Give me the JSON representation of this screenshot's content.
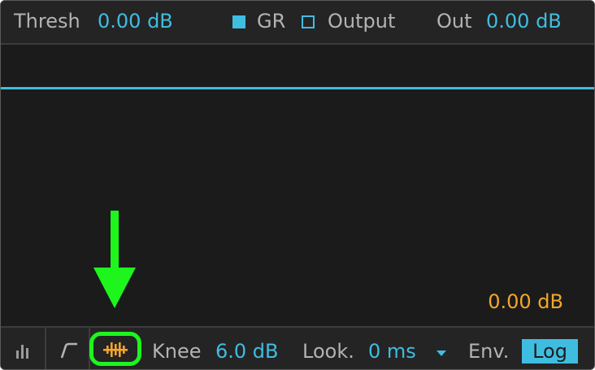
{
  "top_bar": {
    "threshold_label": "Thresh",
    "threshold_value": "0.00 dB",
    "gr_label": "GR",
    "gr_checked": true,
    "output_label": "Output",
    "output_checked": false,
    "out_label": "Out",
    "out_value": "0.00 dB"
  },
  "display": {
    "gr_readout": "0.00 dB"
  },
  "bottom_bar": {
    "knee_label": "Knee",
    "knee_value": "6.0 dB",
    "lookahead_label": "Look.",
    "lookahead_value": "0 ms",
    "envelope_label": "Env.",
    "envelope_mode": "Log"
  },
  "icons": {
    "activity_view": "bar-meter-icon",
    "transfer_curve": "knee-curve-icon",
    "sidechain": "sidechain-waveform-icon",
    "lookahead_menu": "dropdown-triangle-icon"
  },
  "colors": {
    "accent_blue": "#3fbde1",
    "accent_orange": "#f4a62a",
    "highlight_green": "#1df51d",
    "panel_bg": "#1d1d1d"
  }
}
